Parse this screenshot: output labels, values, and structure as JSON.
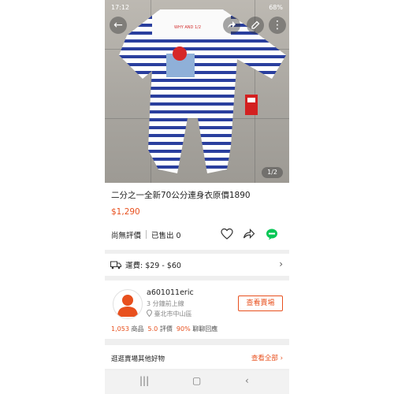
{
  "status_bar": {
    "time": "17:12",
    "battery": "68%"
  },
  "hero": {
    "image_counter": "1/2",
    "logo_text": "WHY AND 1/2"
  },
  "product": {
    "title": "二分之一全新70公分連身衣原價1890",
    "price": "$1,290"
  },
  "stats": {
    "rating_label": "尚無評價",
    "sold_label": "已售出 0"
  },
  "shipping": {
    "label": "運費: $29 - $60"
  },
  "seller": {
    "name": "a601011eric",
    "last_login": "3 分鐘前上線",
    "location": "臺北市中山區",
    "visit_label": "查看賣場",
    "product_count": "1,053",
    "product_label": "商品",
    "rating_value": "5.0",
    "rating_label": "評價",
    "reply_rate": "90%",
    "reply_label": "聊聊回應"
  },
  "more": {
    "label": "逛逛賣場其他好物",
    "see_all": "查看全部"
  },
  "colors": {
    "accent": "#e8501e",
    "stripe_blue": "#2a3f9e",
    "line_green": "#06c755"
  }
}
